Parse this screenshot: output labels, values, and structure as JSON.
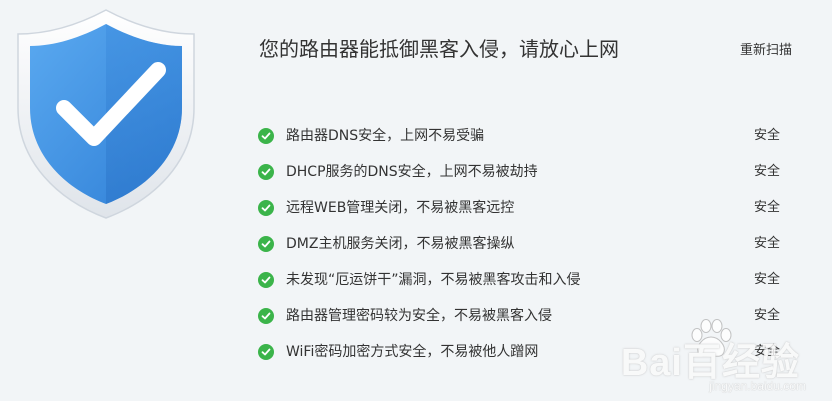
{
  "header": {
    "title": "您的路由器能抵御黑客入侵，请放心上网",
    "rescan_label": "重新扫描"
  },
  "shield": {
    "icon": "shield-check-icon",
    "color": "#3a8ee6"
  },
  "checks": [
    {
      "label": "路由器DNS安全，上网不易受骗",
      "status": "安全",
      "icon": "check-circle-icon"
    },
    {
      "label": "DHCP服务的DNS安全，上网不易被劫持",
      "status": "安全",
      "icon": "check-circle-icon"
    },
    {
      "label": "远程WEB管理关闭，不易被黑客远控",
      "status": "安全",
      "icon": "check-circle-icon"
    },
    {
      "label": "DMZ主机服务关闭，不易被黑客操纵",
      "status": "安全",
      "icon": "check-circle-icon"
    },
    {
      "label": "未发现“厄运饼干”漏洞，不易被黑客攻击和入侵",
      "status": "安全",
      "icon": "check-circle-icon"
    },
    {
      "label": "路由器管理密码较为安全，不易被黑客入侵",
      "status": "安全",
      "icon": "check-circle-icon"
    },
    {
      "label": "WiFi密码加密方式安全，不易被他人蹭网",
      "status": "安全",
      "icon": "check-circle-icon"
    }
  ],
  "colors": {
    "accent_green": "#3bb44a",
    "shield_blue": "#3a8ee6",
    "background": "#f2f5f7"
  },
  "watermark": {
    "brand": "Bai百经验",
    "url": "jingyan.baidu.com"
  }
}
